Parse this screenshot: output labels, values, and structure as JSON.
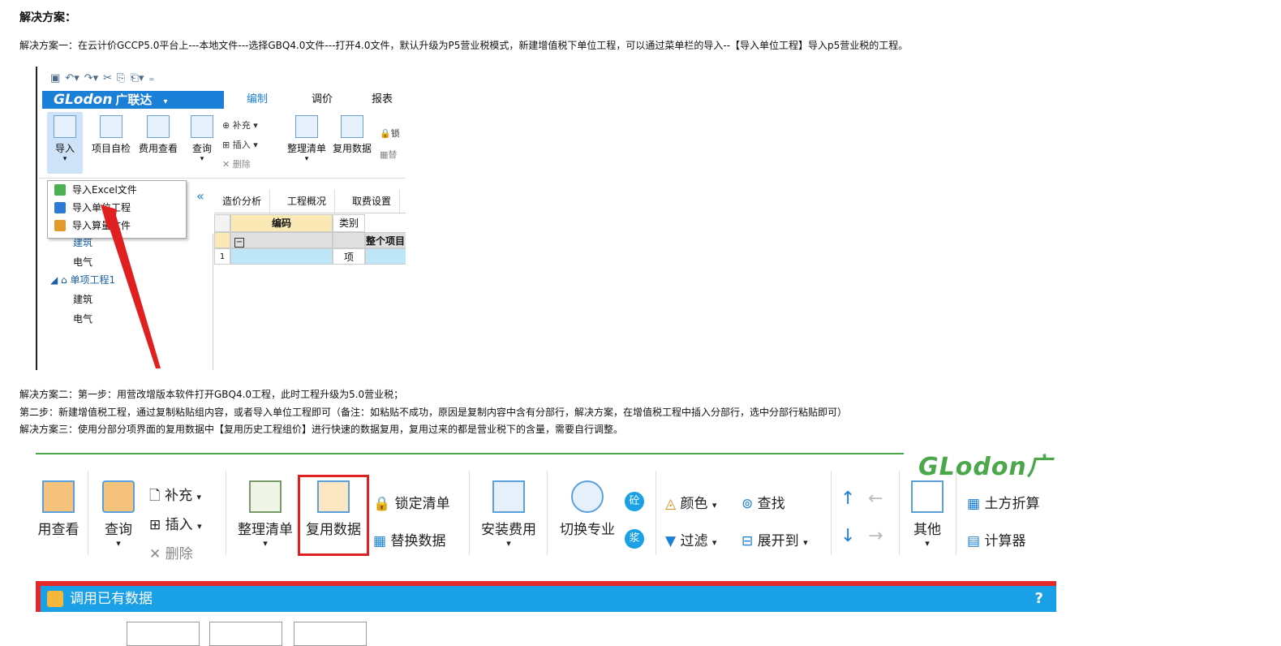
{
  "heading": "解决方案：",
  "solution1": "解决方案一：在云计价GCCP5.0平台上---本地文件---选择GBQ4.0文件---打开4.0文件，默认升级为P5营业税模式，新建增值税下单位工程，可以通过菜单栏的导入--【导入单位工程】导入p5营业税的工程。",
  "solution2_step1": "解决方案二：第一步：用营改增版本软件打开GBQ4.0工程，此时工程升级为5.0营业税；",
  "solution2_step2": "第二步：新建增值税工程，通过复制粘贴组内容，或者导入单位工程即可（备注：如粘贴不成功，原因是复制内容中含有分部行，解决方案，在增值税工程中插入分部行，选中分部行粘贴即可）",
  "solution3": "解决方案三：使用分部分项界面的复用数据中【复用历史工程组价】进行快速的数据复用，复用过来的都是营业税下的含量，需要自行调整。",
  "shot1": {
    "brand": "GLodon",
    "brand_cn": "广联达",
    "tabs": [
      "编制",
      "调价",
      "报表"
    ],
    "ribbon": {
      "import": "导入",
      "self_check": "项目自检",
      "fee_view": "费用查看",
      "query": "查询",
      "supplement": "补充",
      "insert": "插入",
      "delete": "删除",
      "organize": "整理清单",
      "reuse": "复用数据",
      "lock": "锁",
      "replace": "替"
    },
    "menu": [
      "导入Excel文件",
      "导入单位工程",
      "导入算量文件"
    ],
    "collapse": "«",
    "subtabs": [
      "造价分析",
      "工程概况",
      "取费设置"
    ],
    "grid": {
      "col_code": "编码",
      "col_type": "类别",
      "row_whole": "整个项目",
      "row1_num": "1",
      "row1_type": "项",
      "minus": "−"
    },
    "tree": [
      "建筑",
      "电气",
      "单项工程1",
      "建筑",
      "电气"
    ]
  },
  "shot2": {
    "brand": "GLodon广",
    "fee_view": "用查看",
    "query": "查询",
    "supplement": "补充",
    "insert": "插入",
    "delete": "删除",
    "organize": "整理清单",
    "reuse": "复用数据",
    "lock": "锁定清单",
    "replace": "替换数据",
    "install_fee": "安装费用",
    "switch": "切换专业",
    "badge1": "砼",
    "badge2": "浆",
    "color": "颜色",
    "find": "查找",
    "filter": "过滤",
    "expand": "展开到",
    "other": "其他",
    "earthwork": "土方折算",
    "calculator": "计算器",
    "dialog_title": "调用已有数据",
    "help": "?"
  },
  "colors": {
    "brand_blue": "#1a7fd6",
    "highlight_red": "#e02020",
    "dialog_blue": "#1aa0e6",
    "brand_green": "#4aa84a"
  }
}
